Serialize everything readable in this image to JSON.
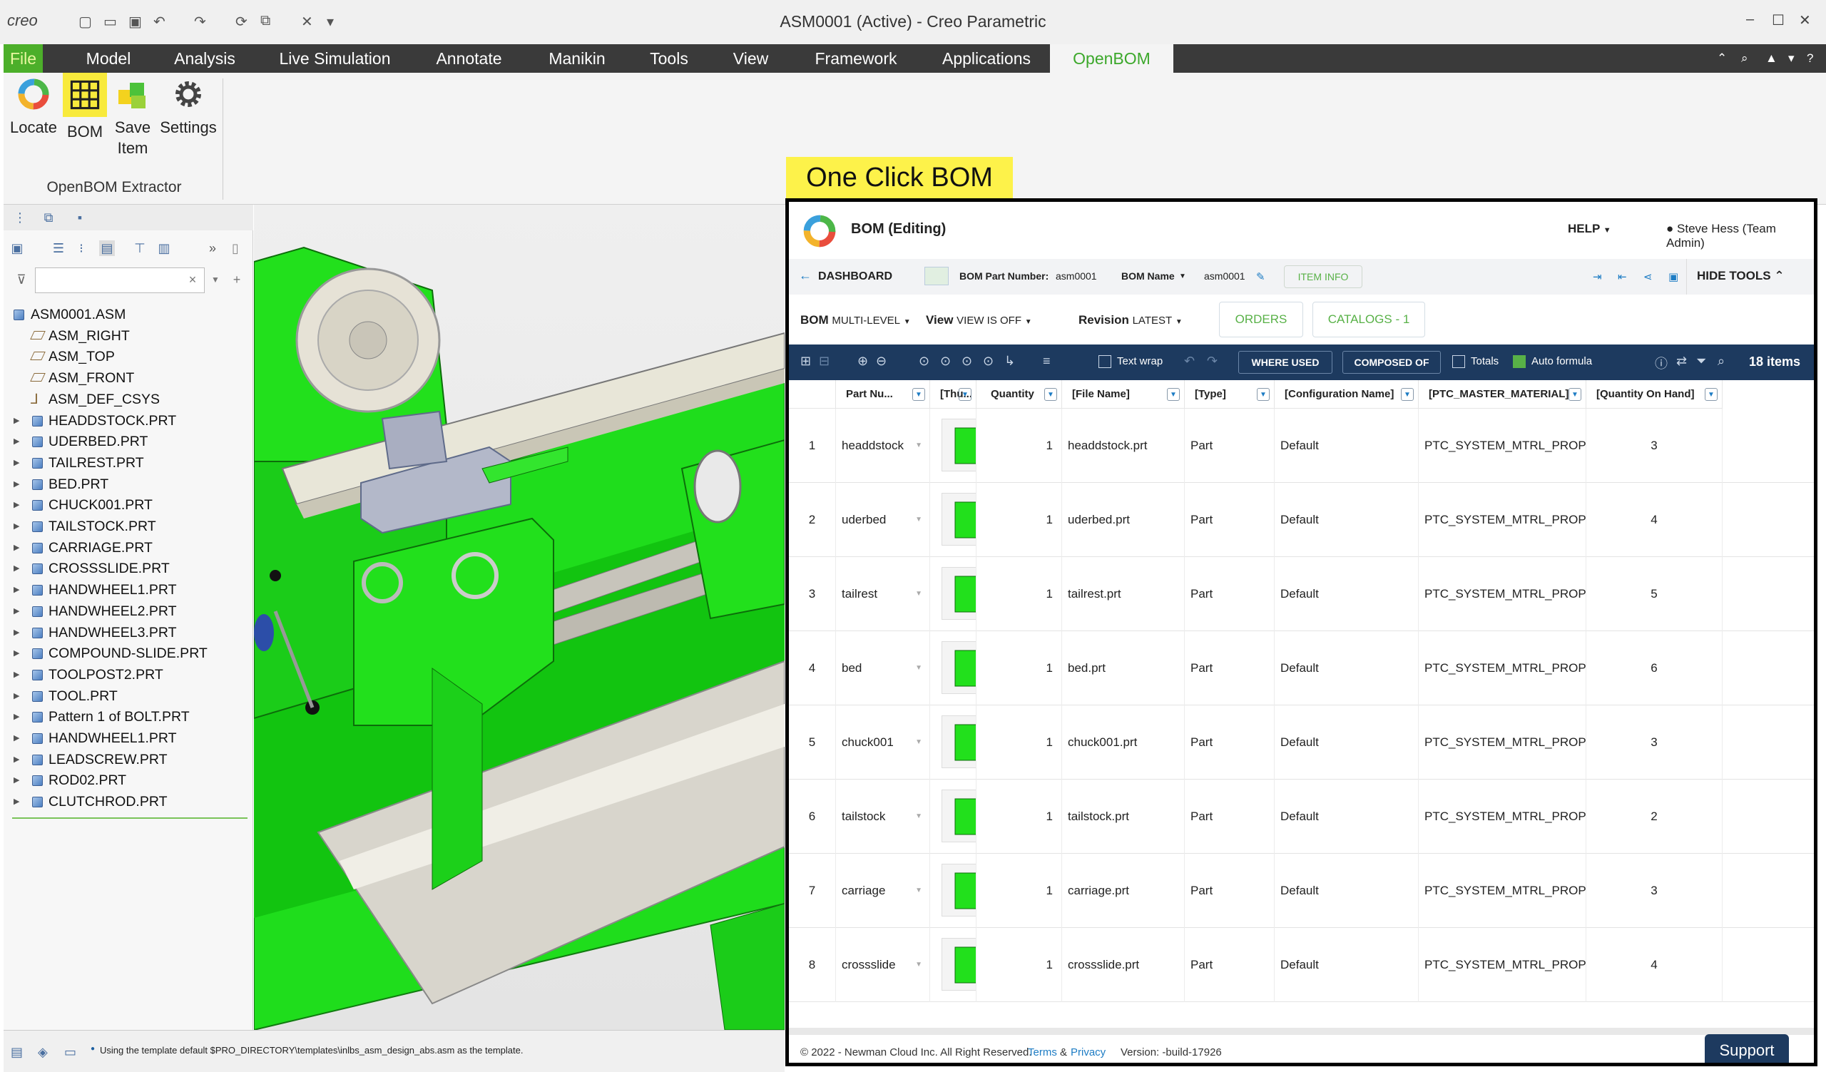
{
  "window": {
    "title": "ASM0001 (Active) - Creo Parametric",
    "app_logo": "creo"
  },
  "ribbon_tabs": [
    "File",
    "Model",
    "Analysis",
    "Live Simulation",
    "Annotate",
    "Manikin",
    "Tools",
    "View",
    "Framework",
    "Applications",
    "OpenBOM"
  ],
  "ribbon": {
    "buttons": [
      {
        "label": "Locate",
        "icon": "openbom-logo-icon"
      },
      {
        "label": "BOM",
        "icon": "grid-icon"
      },
      {
        "label": "Save Item",
        "icon": "cubes-icon"
      },
      {
        "label": "Settings",
        "icon": "gear-icon"
      }
    ],
    "group_label": "OpenBOM Extractor"
  },
  "model_tree": {
    "search_placeholder": "",
    "items": [
      {
        "label": "ASM0001.ASM",
        "type": "assembly"
      },
      {
        "label": "ASM_RIGHT",
        "type": "datum-plane"
      },
      {
        "label": "ASM_TOP",
        "type": "datum-plane"
      },
      {
        "label": "ASM_FRONT",
        "type": "datum-plane"
      },
      {
        "label": "ASM_DEF_CSYS",
        "type": "csys"
      },
      {
        "label": "HEADDSTOCK.PRT",
        "type": "part"
      },
      {
        "label": "UDERBED.PRT",
        "type": "part"
      },
      {
        "label": "TAILREST.PRT",
        "type": "part"
      },
      {
        "label": "BED.PRT",
        "type": "part"
      },
      {
        "label": "CHUCK001.PRT",
        "type": "part"
      },
      {
        "label": "TAILSTOCK.PRT",
        "type": "part"
      },
      {
        "label": "CARRIAGE.PRT",
        "type": "part"
      },
      {
        "label": "CROSSSLIDE.PRT",
        "type": "part"
      },
      {
        "label": "HANDWHEEL1.PRT",
        "type": "part"
      },
      {
        "label": "HANDWHEEL2.PRT",
        "type": "part"
      },
      {
        "label": "HANDWHEEL3.PRT",
        "type": "part"
      },
      {
        "label": "COMPOUND-SLIDE.PRT",
        "type": "part"
      },
      {
        "label": "TOOLPOST2.PRT",
        "type": "part"
      },
      {
        "label": "TOOL.PRT",
        "type": "part"
      },
      {
        "label": "Pattern 1 of BOLT.PRT",
        "type": "pattern"
      },
      {
        "label": "HANDWHEEL1.PRT",
        "type": "part"
      },
      {
        "label": "LEADSCREW.PRT",
        "type": "part"
      },
      {
        "label": "ROD02.PRT",
        "type": "part"
      },
      {
        "label": "CLUTCHROD.PRT",
        "type": "part"
      }
    ]
  },
  "status_message": "Using the template default $PRO_DIRECTORY\\templates\\inlbs_asm_design_abs.asm as the template.",
  "callout": "One Click BOM",
  "bom": {
    "title": "BOM (Editing)",
    "help": "HELP",
    "user": "Steve Hess (Team Admin)",
    "dashboard": "DASHBOARD",
    "part_number_label": "BOM Part Number:",
    "part_number": "asm0001",
    "name_label": "BOM Name",
    "name": "asm0001",
    "item_info": "ITEM INFO",
    "hide_tools": "HIDE TOOLS",
    "view_bom_label": "BOM",
    "view_bom_value": "MULTI-LEVEL",
    "view_label": "View",
    "view_value": "VIEW IS OFF",
    "revision_label": "Revision",
    "revision_value": "LATEST",
    "orders": "ORDERS",
    "catalogs": "CATALOGS - 1",
    "text_wrap": "Text wrap",
    "where_used": "WHERE USED",
    "composed_of": "COMPOSED OF",
    "totals": "Totals",
    "auto_formula": "Auto formula",
    "item_count": "18 items",
    "columns": [
      "Part Nu...",
      "[Thu...",
      "Quantity",
      "[File Name]",
      "[Type]",
      "[Configuration Name]",
      "[PTC_MASTER_MATERIAL]",
      "[Quantity On Hand]"
    ],
    "rows": [
      {
        "n": "1",
        "part": "headdstock",
        "qty": "1",
        "file": "headdstock.prt",
        "type": "Part",
        "config": "Default",
        "material": "PTC_SYSTEM_MTRL_PROPS",
        "onhand": "3"
      },
      {
        "n": "2",
        "part": "uderbed",
        "qty": "1",
        "file": "uderbed.prt",
        "type": "Part",
        "config": "Default",
        "material": "PTC_SYSTEM_MTRL_PROPS",
        "onhand": "4"
      },
      {
        "n": "3",
        "part": "tailrest",
        "qty": "1",
        "file": "tailrest.prt",
        "type": "Part",
        "config": "Default",
        "material": "PTC_SYSTEM_MTRL_PROPS",
        "onhand": "5"
      },
      {
        "n": "4",
        "part": "bed",
        "qty": "1",
        "file": "bed.prt",
        "type": "Part",
        "config": "Default",
        "material": "PTC_SYSTEM_MTRL_PROPS",
        "onhand": "6"
      },
      {
        "n": "5",
        "part": "chuck001",
        "qty": "1",
        "file": "chuck001.prt",
        "type": "Part",
        "config": "Default",
        "material": "PTC_SYSTEM_MTRL_PROPS",
        "onhand": "3"
      },
      {
        "n": "6",
        "part": "tailstock",
        "qty": "1",
        "file": "tailstock.prt",
        "type": "Part",
        "config": "Default",
        "material": "PTC_SYSTEM_MTRL_PROPS",
        "onhand": "2"
      },
      {
        "n": "7",
        "part": "carriage",
        "qty": "1",
        "file": "carriage.prt",
        "type": "Part",
        "config": "Default",
        "material": "PTC_SYSTEM_MTRL_PROPS",
        "onhand": "3"
      },
      {
        "n": "8",
        "part": "crossslide",
        "qty": "1",
        "file": "crossslide.prt",
        "type": "Part",
        "config": "Default",
        "material": "PTC_SYSTEM_MTRL_PROPS",
        "onhand": "4"
      }
    ],
    "footer_copyright": "© 2022 - Newman Cloud Inc. All Right Reserved.",
    "footer_terms": "Terms",
    "footer_amp": "&",
    "footer_privacy": "Privacy",
    "footer_version": "Version: -build-17926",
    "support": "Support"
  },
  "colors": {
    "accent_green": "#3ca82b",
    "bom_navy": "#1d3a5f",
    "callout_yellow": "#fdf24a",
    "model_green": "#22e01c"
  }
}
